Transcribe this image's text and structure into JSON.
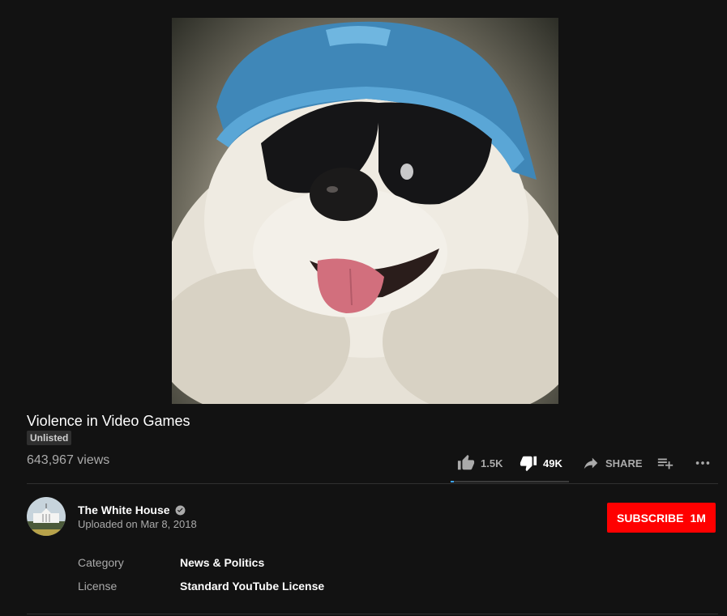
{
  "video": {
    "title": "Violence in Video Games",
    "badge": "Unlisted",
    "views": "643,967 views"
  },
  "actions": {
    "like_count": "1.5K",
    "dislike_count": "49K",
    "share_label": "SHARE",
    "like_ratio": 0.03
  },
  "channel": {
    "name": "The White House",
    "uploaded": "Uploaded on Mar 8, 2018",
    "subscribe_label": "SUBSCRIBE",
    "subscriber_count": "1M"
  },
  "metadata": [
    {
      "label": "Category",
      "value": "News & Politics"
    },
    {
      "label": "License",
      "value": "Standard YouTube License"
    }
  ],
  "icons": {
    "like": "thumb-up-icon",
    "dislike": "thumb-down-icon",
    "share": "share-arrow-icon",
    "save": "playlist-add-icon",
    "more": "more-horizontal-icon",
    "verified": "verified-check-icon"
  },
  "colors": {
    "background": "#121212",
    "subscribe": "#ff0000",
    "accent": "#3ea6ff",
    "secondary_text": "#aaaaaa"
  }
}
